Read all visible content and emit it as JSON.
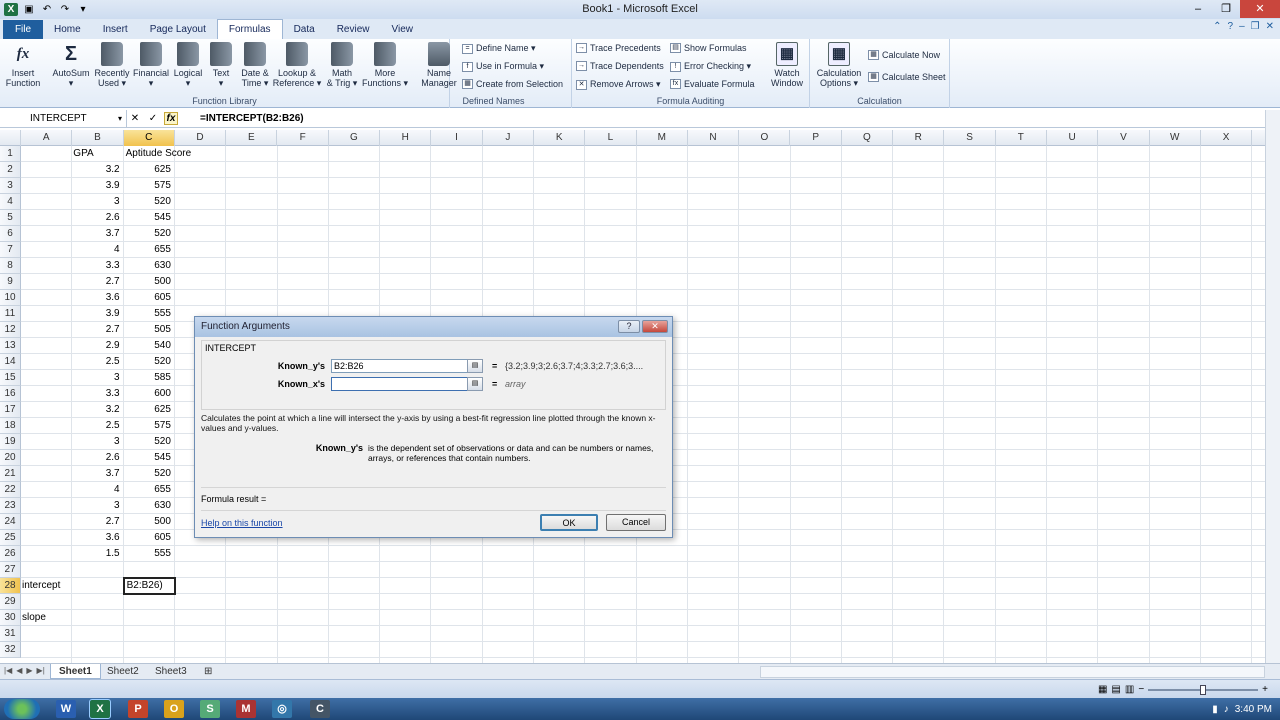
{
  "window": {
    "title": "Book1 - Microsoft Excel"
  },
  "tabs": [
    "File",
    "Home",
    "Insert",
    "Page Layout",
    "Formulas",
    "Data",
    "Review",
    "View"
  ],
  "active_tab": "Formulas",
  "ribbon": {
    "function_library": {
      "label": "Function Library",
      "buttons": [
        {
          "l1": "Insert",
          "l2": "Function"
        },
        {
          "l1": "AutoSum",
          "l2": "▾"
        },
        {
          "l1": "Recently",
          "l2": "Used ▾"
        },
        {
          "l1": "Financial",
          "l2": "▾"
        },
        {
          "l1": "Logical",
          "l2": "▾"
        },
        {
          "l1": "Text",
          "l2": "▾"
        },
        {
          "l1": "Date &",
          "l2": "Time ▾"
        },
        {
          "l1": "Lookup &",
          "l2": "Reference ▾"
        },
        {
          "l1": "Math",
          "l2": "& Trig ▾"
        },
        {
          "l1": "More",
          "l2": "Functions ▾"
        }
      ]
    },
    "defined_names": {
      "label": "Defined Names",
      "name_manager_l1": "Name",
      "name_manager_l2": "Manager",
      "items": [
        "Define Name ▾",
        "Use in Formula ▾",
        "Create from Selection"
      ]
    },
    "formula_auditing": {
      "label": "Formula Auditing",
      "left": [
        "Trace Precedents",
        "Trace Dependents",
        "Remove Arrows ▾"
      ],
      "right": [
        "Show Formulas",
        "Error Checking ▾",
        "Evaluate Formula"
      ],
      "watch_l1": "Watch",
      "watch_l2": "Window"
    },
    "calculation": {
      "label": "Calculation",
      "options_l1": "Calculation",
      "options_l2": "Options ▾",
      "items": [
        "Calculate Now",
        "Calculate Sheet"
      ]
    }
  },
  "formula_bar": {
    "name_box": "INTERCEPT",
    "formula": "=INTERCEPT(B2:B26)"
  },
  "columns": [
    "A",
    "B",
    "C",
    "D",
    "E",
    "F",
    "G",
    "H",
    "I",
    "J",
    "K",
    "L",
    "M",
    "N",
    "O",
    "P",
    "Q",
    "R",
    "S",
    "T",
    "U",
    "V",
    "W",
    "X"
  ],
  "rows": [
    "1",
    "2",
    "3",
    "4",
    "5",
    "6",
    "7",
    "8",
    "9",
    "10",
    "11",
    "12",
    "13",
    "14",
    "15",
    "16",
    "17",
    "18",
    "19",
    "20",
    "21",
    "22",
    "23",
    "24",
    "25",
    "26",
    "27",
    "28",
    "29",
    "30",
    "31",
    "32"
  ],
  "sheet": {
    "headers": {
      "b1": "GPA",
      "c1": "Aptitude Score"
    },
    "gpa": [
      "3.2",
      "3.9",
      "3",
      "2.6",
      "3.7",
      "4",
      "3.3",
      "2.7",
      "3.6",
      "3.9",
      "2.7",
      "2.9",
      "2.5",
      "3",
      "3.3",
      "3.2",
      "2.5",
      "3",
      "2.6",
      "3.7",
      "4",
      "3",
      "2.7",
      "3.6",
      "1.5"
    ],
    "score": [
      "625",
      "575",
      "520",
      "545",
      "520",
      "655",
      "630",
      "500",
      "605",
      "555",
      "505",
      "540",
      "520",
      "585",
      "600",
      "625",
      "575",
      "520",
      "545",
      "520",
      "655",
      "630",
      "500",
      "605",
      "555"
    ],
    "a28": "intercept",
    "a30": "slope",
    "c28_edit": "B2:B26)"
  },
  "sheet_tabs": [
    "Sheet1",
    "Sheet2",
    "Sheet3"
  ],
  "dialog": {
    "title": "Function Arguments",
    "function_name": "INTERCEPT",
    "arg1_label": "Known_y's",
    "arg1_value": "B2:B26",
    "arg1_result": "{3.2;3.9;3;2.6;3.7;4;3.3;2.7;3.6;3....",
    "arg2_label": "Known_x's",
    "arg2_value": "",
    "arg2_result": "array",
    "eq": "=",
    "description": "Calculates the point at which a line will intersect the y-axis by using a best-fit regression line plotted through the known x-values and y-values.",
    "arg_desc_name": "Known_y's",
    "arg_desc": "is the dependent set of observations or data and can be numbers or names, arrays, or references that contain numbers.",
    "formula_result": "Formula result =",
    "help_link": "Help on this function",
    "ok": "OK",
    "cancel": "Cancel"
  },
  "taskbar": {
    "time": "3:40 PM"
  }
}
